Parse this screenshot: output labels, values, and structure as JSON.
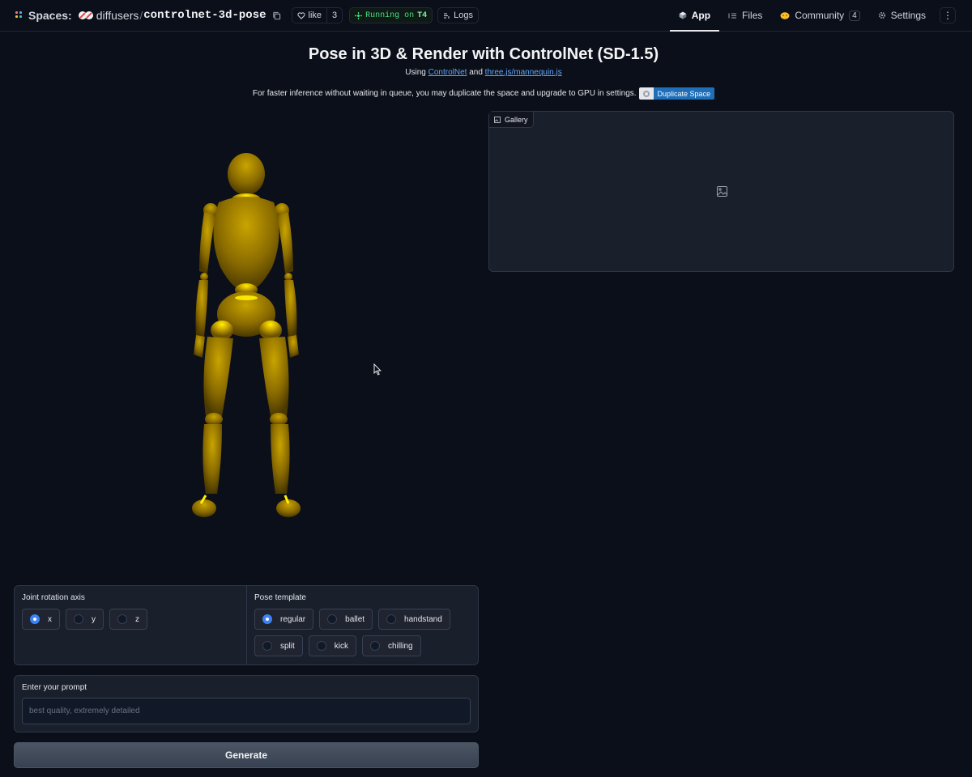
{
  "topbar": {
    "spaces_label": "Spaces:",
    "org": "diffusers",
    "separator": "/",
    "repo": "controlnet-3d-pose",
    "like_label": "like",
    "like_count": "3",
    "running_label": "Running on",
    "running_hw": "T4",
    "logs_label": "Logs",
    "nav": {
      "app": "App",
      "files": "Files",
      "community": "Community",
      "community_count": "4",
      "settings": "Settings"
    }
  },
  "header": {
    "title": "Pose in 3D & Render with ControlNet (SD-1.5)",
    "using_prefix": "Using",
    "link1": "ControlNet",
    "and": "and",
    "link2": "three.js/mannequin.js",
    "notice": "For faster inference without waiting in queue, you may duplicate the space and upgrade to GPU in settings.",
    "duplicate_label": "Duplicate Space"
  },
  "gallery": {
    "label": "Gallery"
  },
  "controls": {
    "axis": {
      "label": "Joint rotation axis",
      "options": [
        "x",
        "y",
        "z"
      ],
      "selected": "x"
    },
    "pose": {
      "label": "Pose template",
      "options": [
        "regular",
        "ballet",
        "handstand",
        "split",
        "kick",
        "chilling"
      ],
      "selected": "regular"
    }
  },
  "prompt": {
    "label": "Enter your prompt",
    "placeholder": "best quality, extremely detailed"
  },
  "generate_label": "Generate",
  "colors": {
    "background": "#0b0f19",
    "mannequin_gold": "#a68000",
    "accent_blue": "#3b82f6",
    "running_green": "#4ade80"
  }
}
